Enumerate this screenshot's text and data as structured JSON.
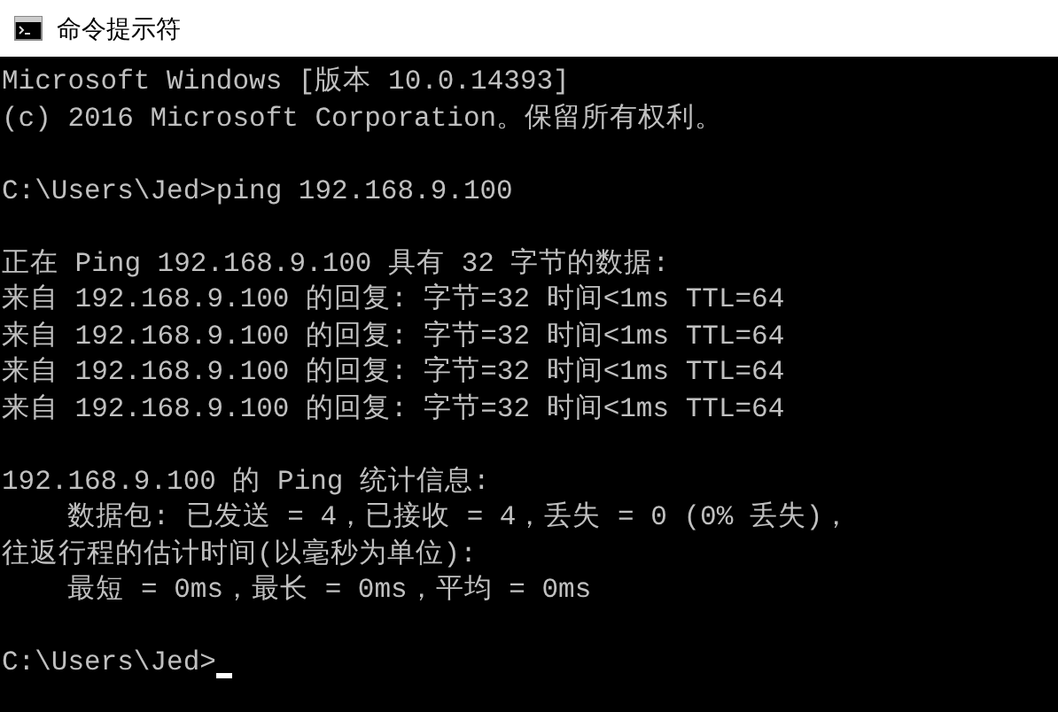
{
  "window": {
    "title": "命令提示符"
  },
  "console": {
    "blocks": [
      [
        "Microsoft Windows [版本 10.0.14393]",
        "(c) 2016 Microsoft Corporation。保留所有权利。"
      ],
      [
        "C:\\Users\\Jed>ping 192.168.9.100"
      ],
      [
        "正在 Ping 192.168.9.100 具有 32 字节的数据:",
        "来自 192.168.9.100 的回复: 字节=32 时间<1ms TTL=64",
        "来自 192.168.9.100 的回复: 字节=32 时间<1ms TTL=64",
        "来自 192.168.9.100 的回复: 字节=32 时间<1ms TTL=64",
        "来自 192.168.9.100 的回复: 字节=32 时间<1ms TTL=64"
      ],
      [
        "192.168.9.100 的 Ping 统计信息:",
        "    数据包: 已发送 = 4，已接收 = 4，丢失 = 0 (0% 丢失)，",
        "往返行程的估计时间(以毫秒为单位):",
        "    最短 = 0ms，最长 = 0ms，平均 = 0ms"
      ]
    ],
    "prompt": {
      "text": "C:\\Users\\Jed>",
      "cursor": true
    }
  }
}
